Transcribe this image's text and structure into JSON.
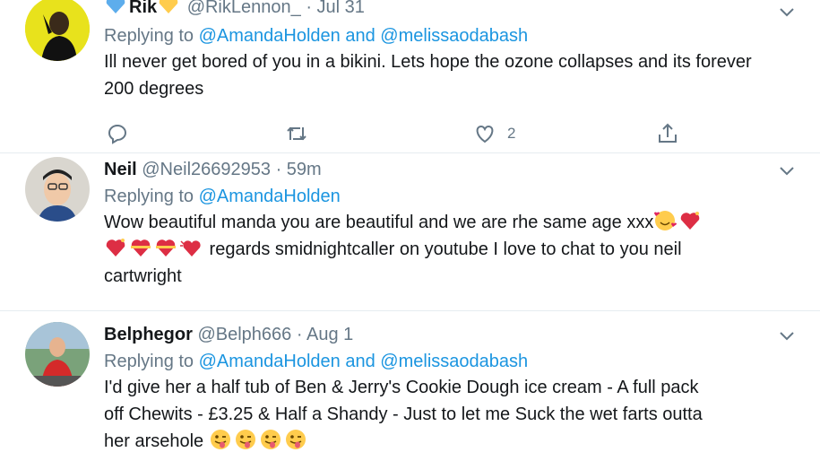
{
  "tweets": [
    {
      "name": "Rik",
      "handle": "@RikLennon_",
      "dot": "·",
      "time": "Jul 31",
      "replying_prefix": "Replying to ",
      "replying_to": [
        "@AmandaHolden",
        "@melissaodabash"
      ],
      "and_word": " and ",
      "text": "Ill never get bored of you in a bikini. Lets hope the ozone collapses and its forever 200 degrees",
      "reply_count": "",
      "retweet_count": "",
      "like_count": "2",
      "name_emojis": [
        "blue-heart-emoji",
        "yellow-heart-emoji"
      ]
    },
    {
      "name": "Neil",
      "handle": "@Neil26692953",
      "dot": "·",
      "time": "59m",
      "replying_prefix": "Replying to ",
      "replying_to": [
        "@AmandaHolden"
      ],
      "text_line1": "Wow beautiful manda you are beautiful and we are rhe same age xxx",
      "text_line2": " regards smidnightcaller on youtube I love to chat to you neil",
      "text_line3": "cartwright",
      "emojis": [
        "smiling-face-with-hearts-emoji",
        "sparkling-heart-emoji",
        "sparkling-heart-emoji",
        "heart-with-ribbon-emoji",
        "heart-with-ribbon-emoji",
        "beating-heart-emoji"
      ]
    },
    {
      "name": "Belphegor",
      "handle": "@Belph666",
      "dot": "·",
      "time": "Aug 1",
      "replying_prefix": "Replying to ",
      "replying_to": [
        "@AmandaHolden",
        "@melissaodabash"
      ],
      "and_word": " and ",
      "text_line1": "I'd give her a half tub of Ben & Jerry's Cookie Dough ice cream  - A full pack",
      "text_line2": "off Chewits  - £3.25 & Half a Shandy - Just to let me Suck the wet farts outta",
      "text_line3": "her arsehole ",
      "emojis": [
        "winking-tongue-face-emoji",
        "winking-tongue-face-emoji",
        "winking-tongue-face-emoji",
        "winking-tongue-face-emoji"
      ]
    }
  ],
  "colors": {
    "link": "#1b95e0",
    "muted": "#657786",
    "text": "#14171a",
    "divider": "#e6ecf0"
  }
}
